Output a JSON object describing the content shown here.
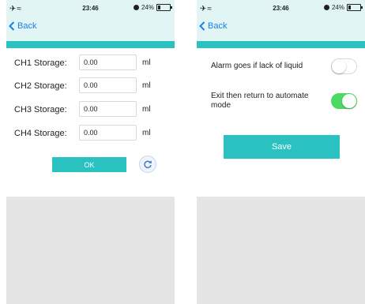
{
  "status_bar": {
    "time": "23:46",
    "battery": "24%",
    "battery_level": 0.24
  },
  "nav": {
    "back_label": "Back"
  },
  "storage_form": {
    "rows": [
      {
        "label": "CH1 Storage:",
        "value": "0.00",
        "unit": "ml"
      },
      {
        "label": "CH2 Storage:",
        "value": "0.00",
        "unit": "ml"
      },
      {
        "label": "CH3 Storage:",
        "value": "0.00",
        "unit": "ml"
      },
      {
        "label": "CH4 Storage:",
        "value": "0.00",
        "unit": "ml"
      }
    ],
    "ok_label": "OK"
  },
  "settings": {
    "alarm_label": "Alarm goes if lack of liquid",
    "alarm_on": false,
    "exit_label": "Exit then return to automate mode",
    "exit_on": true,
    "save_label": "Save"
  },
  "colors": {
    "accent": "#2ac1c1",
    "header_bg": "#e0f5f4",
    "link": "#1a7fe8",
    "toggle_on": "#4cd964",
    "empty_area": "#e5e5e5"
  },
  "icons": [
    "airplane-icon",
    "wifi-icon",
    "alarm-icon",
    "battery-icon",
    "chevron-left-icon",
    "refresh-icon"
  ]
}
